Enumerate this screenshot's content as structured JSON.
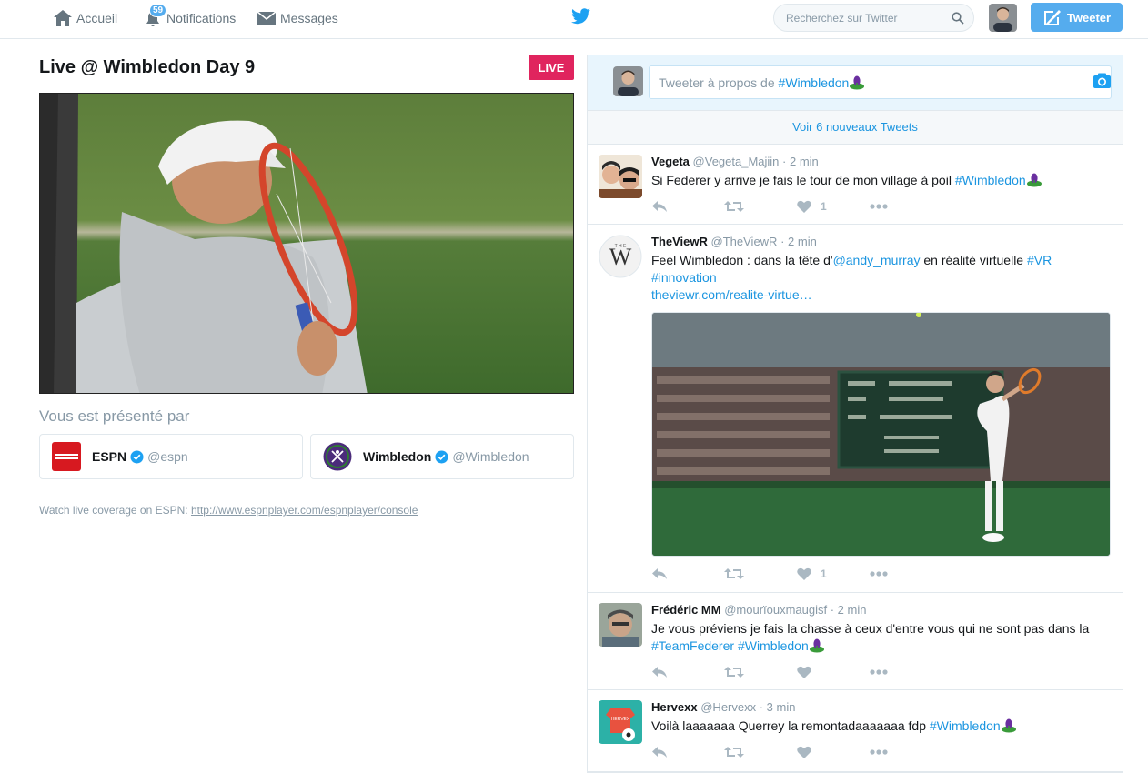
{
  "topbar": {
    "home_label": "Accueil",
    "notifications_label": "Notifications",
    "notifications_count": "59",
    "messages_label": "Messages",
    "search_placeholder": "Recherchez sur Twitter",
    "tweet_button_label": "Tweeter",
    "brand_color": "#55acee"
  },
  "event": {
    "title": "Live @ Wimbledon Day 9",
    "live_label": "LIVE",
    "presented_by": "Vous est présenté par",
    "sponsors": [
      {
        "name": "ESPN",
        "handle": "@espn"
      },
      {
        "name": "Wimbledon",
        "handle": "@Wimbledon"
      }
    ],
    "watch_text": "Watch live coverage on ESPN: ",
    "watch_link": "http://www.espnplayer.com/espnplayer/console"
  },
  "compose": {
    "placeholder_prefix": "Tweeter à propos de ",
    "hashtag": "#Wimbledon"
  },
  "new_tweets_label": "Voir 6 nouveaux Tweets",
  "tweets": [
    {
      "name": "Vegeta",
      "handle": "@Vegeta_Majiin",
      "time": "· 2 min",
      "text": "Si Federer y arrive je fais le tour de mon village à poil ",
      "tag": "#Wimbledon",
      "likes": "1"
    },
    {
      "name": "TheViewR",
      "handle": "@TheViewR",
      "time": "· 2 min",
      "text_a": "Feel Wimbledon : dans la tête d'",
      "mention": "@andy_murray",
      "text_b": " en réalité virtuelle ",
      "tag_vr": "#VR",
      "tag_innov": "#innovation",
      "url": "theviewr.com/realite-virtue…",
      "likes": "1"
    },
    {
      "name": "Frédéric MM",
      "handle": "@mourïouxmaugisf",
      "time": "· 2 min",
      "text": "Je vous préviens je fais la chasse à ceux d'entre vous qui ne sont pas dans la ",
      "tag_a": "#TeamFederer",
      "tag_b": "#Wimbledon"
    },
    {
      "name": "Hervexx",
      "handle": "@Hervexx",
      "time": "· 3 min",
      "text": "Voilà laaaaaaa Querrey la remontadaaaaaaa fdp ",
      "tag": "#Wimbledon"
    }
  ]
}
